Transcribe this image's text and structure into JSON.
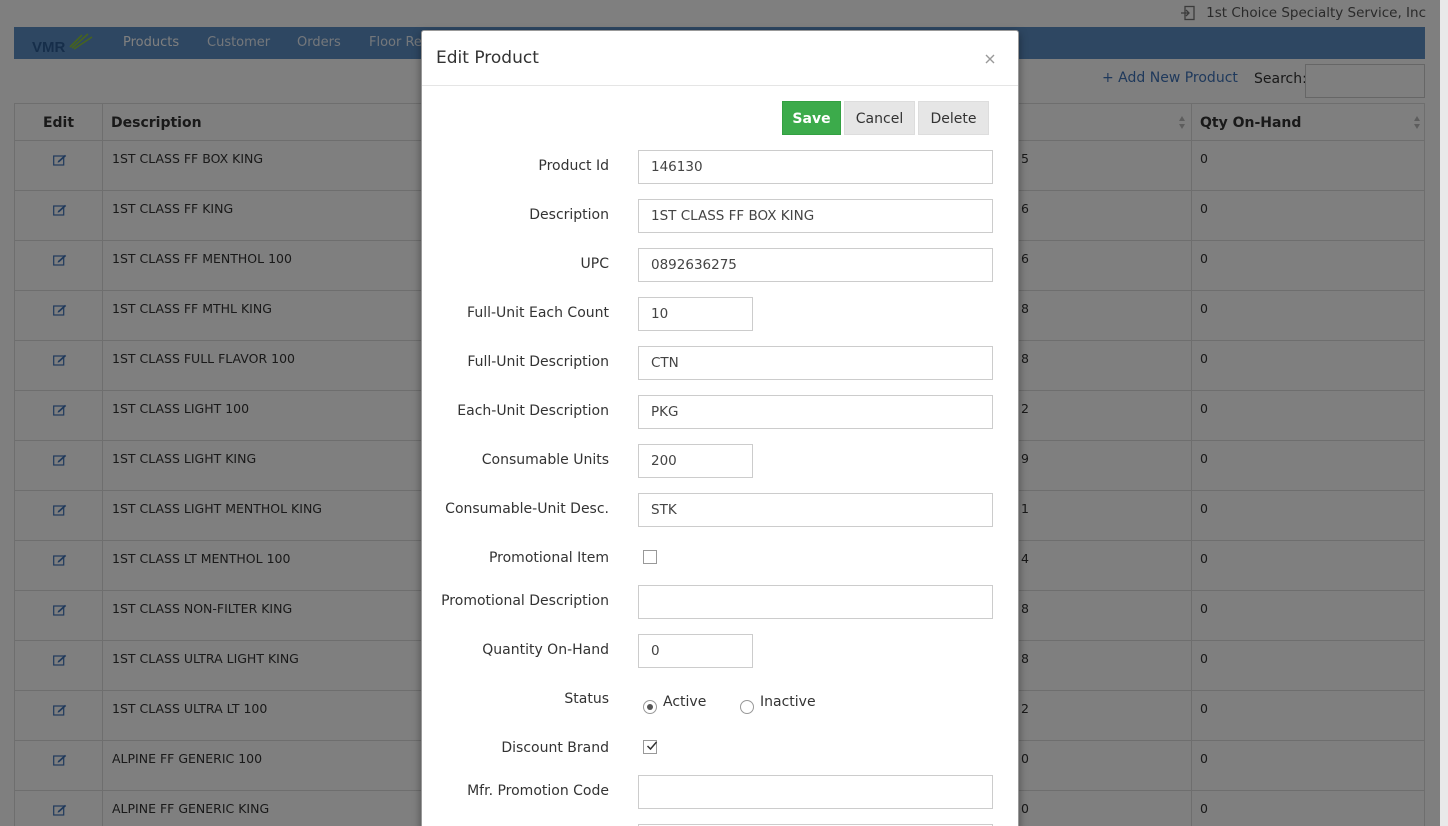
{
  "header": {
    "company_name": "1st Choice Specialty Service, Inc",
    "logo_text": "VMR"
  },
  "nav": {
    "items": [
      {
        "label": "Products",
        "active": true
      },
      {
        "label": "Customer",
        "active": false
      },
      {
        "label": "Orders",
        "active": false
      },
      {
        "label": "Floor Re",
        "active": false
      }
    ]
  },
  "toolbar": {
    "add_new_label": "+ Add New Product",
    "search_label": "Search:",
    "search_value": ""
  },
  "table": {
    "columns": {
      "edit": "Edit",
      "description": "Description",
      "qty_on_hand": "Qty On-Hand"
    },
    "rows": [
      {
        "description": "1ST CLASS FF BOX KING",
        "partial": "5",
        "qty": "0"
      },
      {
        "description": "1ST CLASS FF KING",
        "partial": "6",
        "qty": "0"
      },
      {
        "description": "1ST CLASS FF MENTHOL 100",
        "partial": "6",
        "qty": "0"
      },
      {
        "description": "1ST CLASS FF MTHL KING",
        "partial": "8",
        "qty": "0"
      },
      {
        "description": "1ST CLASS FULL FLAVOR 100",
        "partial": "8",
        "qty": "0"
      },
      {
        "description": "1ST CLASS LIGHT 100",
        "partial": "2",
        "qty": "0"
      },
      {
        "description": "1ST CLASS LIGHT KING",
        "partial": "9",
        "qty": "0"
      },
      {
        "description": "1ST CLASS LIGHT MENTHOL KING",
        "partial": "1",
        "qty": "0"
      },
      {
        "description": "1ST CLASS LT MENTHOL 100",
        "partial": "4",
        "qty": "0"
      },
      {
        "description": "1ST CLASS NON-FILTER KING",
        "partial": "8",
        "qty": "0"
      },
      {
        "description": "1ST CLASS ULTRA LIGHT KING",
        "partial": "8",
        "qty": "0"
      },
      {
        "description": "1ST CLASS ULTRA LT 100",
        "partial": "2",
        "qty": "0"
      },
      {
        "description": "ALPINE FF GENERIC 100",
        "partial": "0",
        "qty": "0"
      },
      {
        "description": "ALPINE FF GENERIC KING",
        "partial": "0",
        "qty": "0"
      }
    ]
  },
  "modal": {
    "title": "Edit Product",
    "buttons": {
      "save": "Save",
      "cancel": "Cancel",
      "delete": "Delete"
    },
    "fields": {
      "product_id": {
        "label": "Product Id",
        "value": "146130"
      },
      "description": {
        "label": "Description",
        "value": "1ST CLASS FF BOX KING"
      },
      "upc": {
        "label": "UPC",
        "value": "0892636275"
      },
      "full_unit_each_count": {
        "label": "Full-Unit Each Count",
        "value": "10"
      },
      "full_unit_description": {
        "label": "Full-Unit Description",
        "value": "CTN"
      },
      "each_unit_description": {
        "label": "Each-Unit Description",
        "value": "PKG"
      },
      "consumable_units": {
        "label": "Consumable Units",
        "value": "200"
      },
      "consumable_unit_desc": {
        "label": "Consumable-Unit Desc.",
        "value": "STK"
      },
      "promotional_item": {
        "label": "Promotional Item",
        "checked": false
      },
      "promotional_description": {
        "label": "Promotional Description",
        "value": ""
      },
      "quantity_on_hand": {
        "label": "Quantity On-Hand",
        "value": "0"
      },
      "status": {
        "label": "Status",
        "options": [
          "Active",
          "Inactive"
        ],
        "selected": "Active"
      },
      "discount_brand": {
        "label": "Discount Brand",
        "checked": true
      },
      "mfr_promotion_code": {
        "label": "Mfr. Promotion Code",
        "value": ""
      }
    }
  },
  "colors": {
    "nav_bg": "#5d8fc4",
    "save_green": "#3cab4b",
    "link_blue": "#3f73b8"
  }
}
